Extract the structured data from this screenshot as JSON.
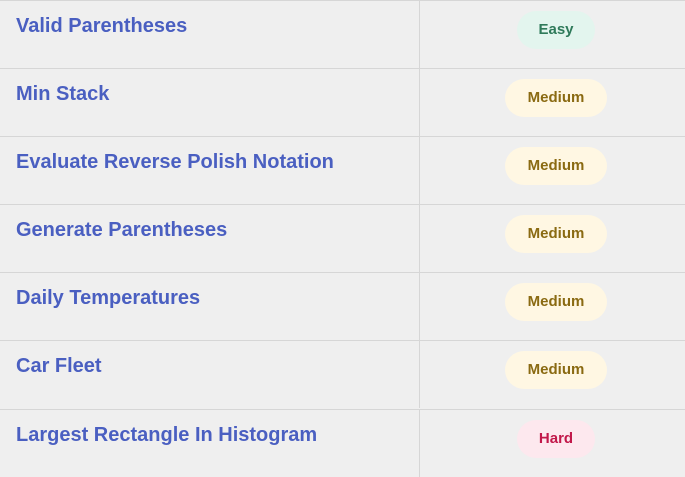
{
  "problems": [
    {
      "title": "Valid Parentheses",
      "difficulty": "Easy"
    },
    {
      "title": "Min Stack",
      "difficulty": "Medium"
    },
    {
      "title": "Evaluate Reverse Polish Notation",
      "difficulty": "Medium"
    },
    {
      "title": "Generate Parentheses",
      "difficulty": "Medium"
    },
    {
      "title": "Daily Temperatures",
      "difficulty": "Medium"
    },
    {
      "title": "Car Fleet",
      "difficulty": "Medium"
    },
    {
      "title": "Largest Rectangle In Histogram",
      "difficulty": "Hard"
    }
  ],
  "colors": {
    "link": "#4a5fc1",
    "easy_bg": "#e3f5ee",
    "easy_text": "#2f7a5a",
    "medium_bg": "#fff7e3",
    "medium_text": "#8a6a12",
    "hard_bg": "#fde8ee",
    "hard_text": "#c2184a"
  }
}
